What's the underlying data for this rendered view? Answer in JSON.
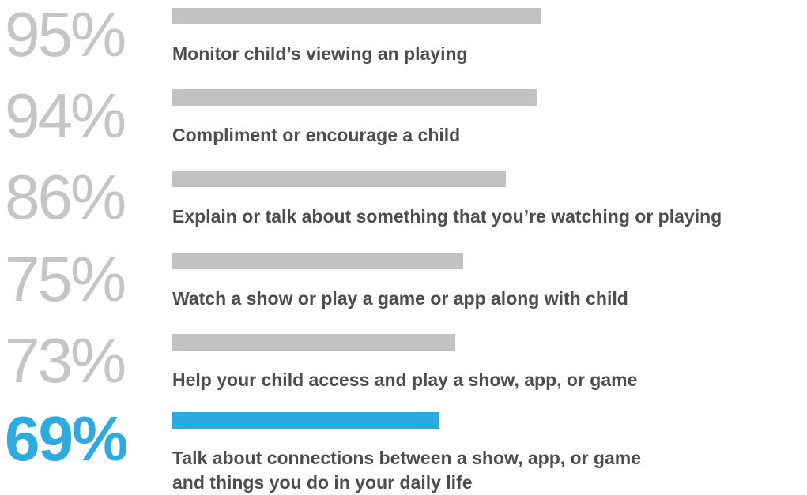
{
  "chart_data": {
    "type": "bar",
    "orientation": "horizontal",
    "categories": [
      "Monitor child’s viewing an playing",
      "Compliment or encourage a child",
      "Explain or talk about something that you’re watching or playing",
      "Watch a show or play a game or app along with child",
      "Help your child access and play a show, app, or game",
      "Talk about connections between a show, app, or game\nand things you do in your daily life"
    ],
    "value_labels": [
      "95%",
      "94%",
      "86%",
      "75%",
      "73%",
      "69%"
    ],
    "values": [
      95,
      94,
      86,
      75,
      73,
      69
    ],
    "unit": "%",
    "highlight_index": 5,
    "colors": {
      "bar": "#c2c2c2",
      "highlight": "#2aabe2",
      "percent_text": "#c5c5c5",
      "label_text": "#4d4d4d"
    },
    "grid": false,
    "legend": "none"
  }
}
